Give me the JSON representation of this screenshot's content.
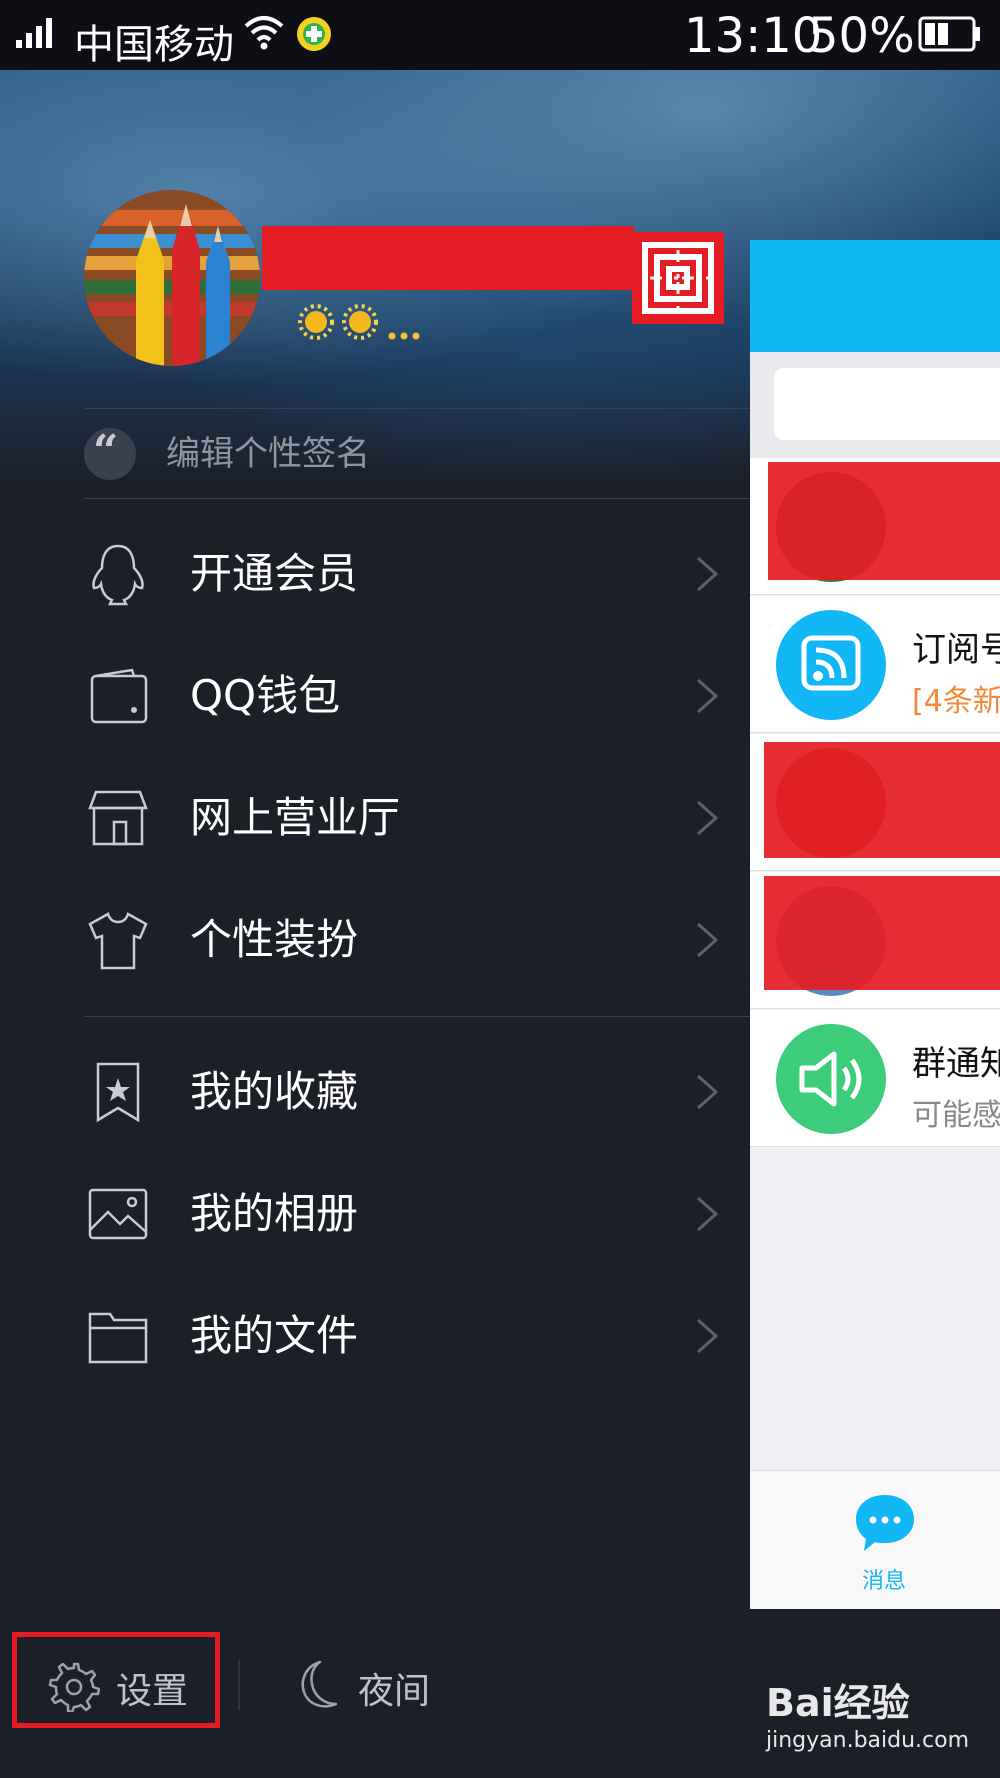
{
  "status_bar": {
    "carrier": "中国移动",
    "time": "13:10",
    "battery": "50%"
  },
  "profile": {
    "signature_placeholder": "编辑个性签名"
  },
  "menu": {
    "group1": [
      {
        "label": "开通会员",
        "icon": "penguin-icon"
      },
      {
        "label": "QQ钱包",
        "icon": "wallet-icon"
      },
      {
        "label": "网上营业厅",
        "icon": "store-icon"
      },
      {
        "label": "个性装扮",
        "icon": "tshirt-icon"
      }
    ],
    "group2": [
      {
        "label": "我的收藏",
        "icon": "bookmark-star-icon"
      },
      {
        "label": "我的相册",
        "icon": "photo-icon"
      },
      {
        "label": "我的文件",
        "icon": "folder-icon"
      }
    ]
  },
  "bottom": {
    "settings_label": "设置",
    "night_label": "夜间"
  },
  "right_panel": {
    "chats": [
      {
        "name": "订阅号",
        "preview": "[4条新"
      },
      {
        "name": "群通知",
        "preview": "可能感"
      }
    ],
    "tab_messages": "消息"
  },
  "watermark": {
    "brand": "Bai经验",
    "url": "jingyan.baidu.com"
  },
  "colors": {
    "accent": "#12b7f5",
    "redaction": "#e61c24",
    "drawer_bg": "#1b1f27",
    "orange_text": "#f5883a",
    "green_icon": "#3ccc7a"
  }
}
